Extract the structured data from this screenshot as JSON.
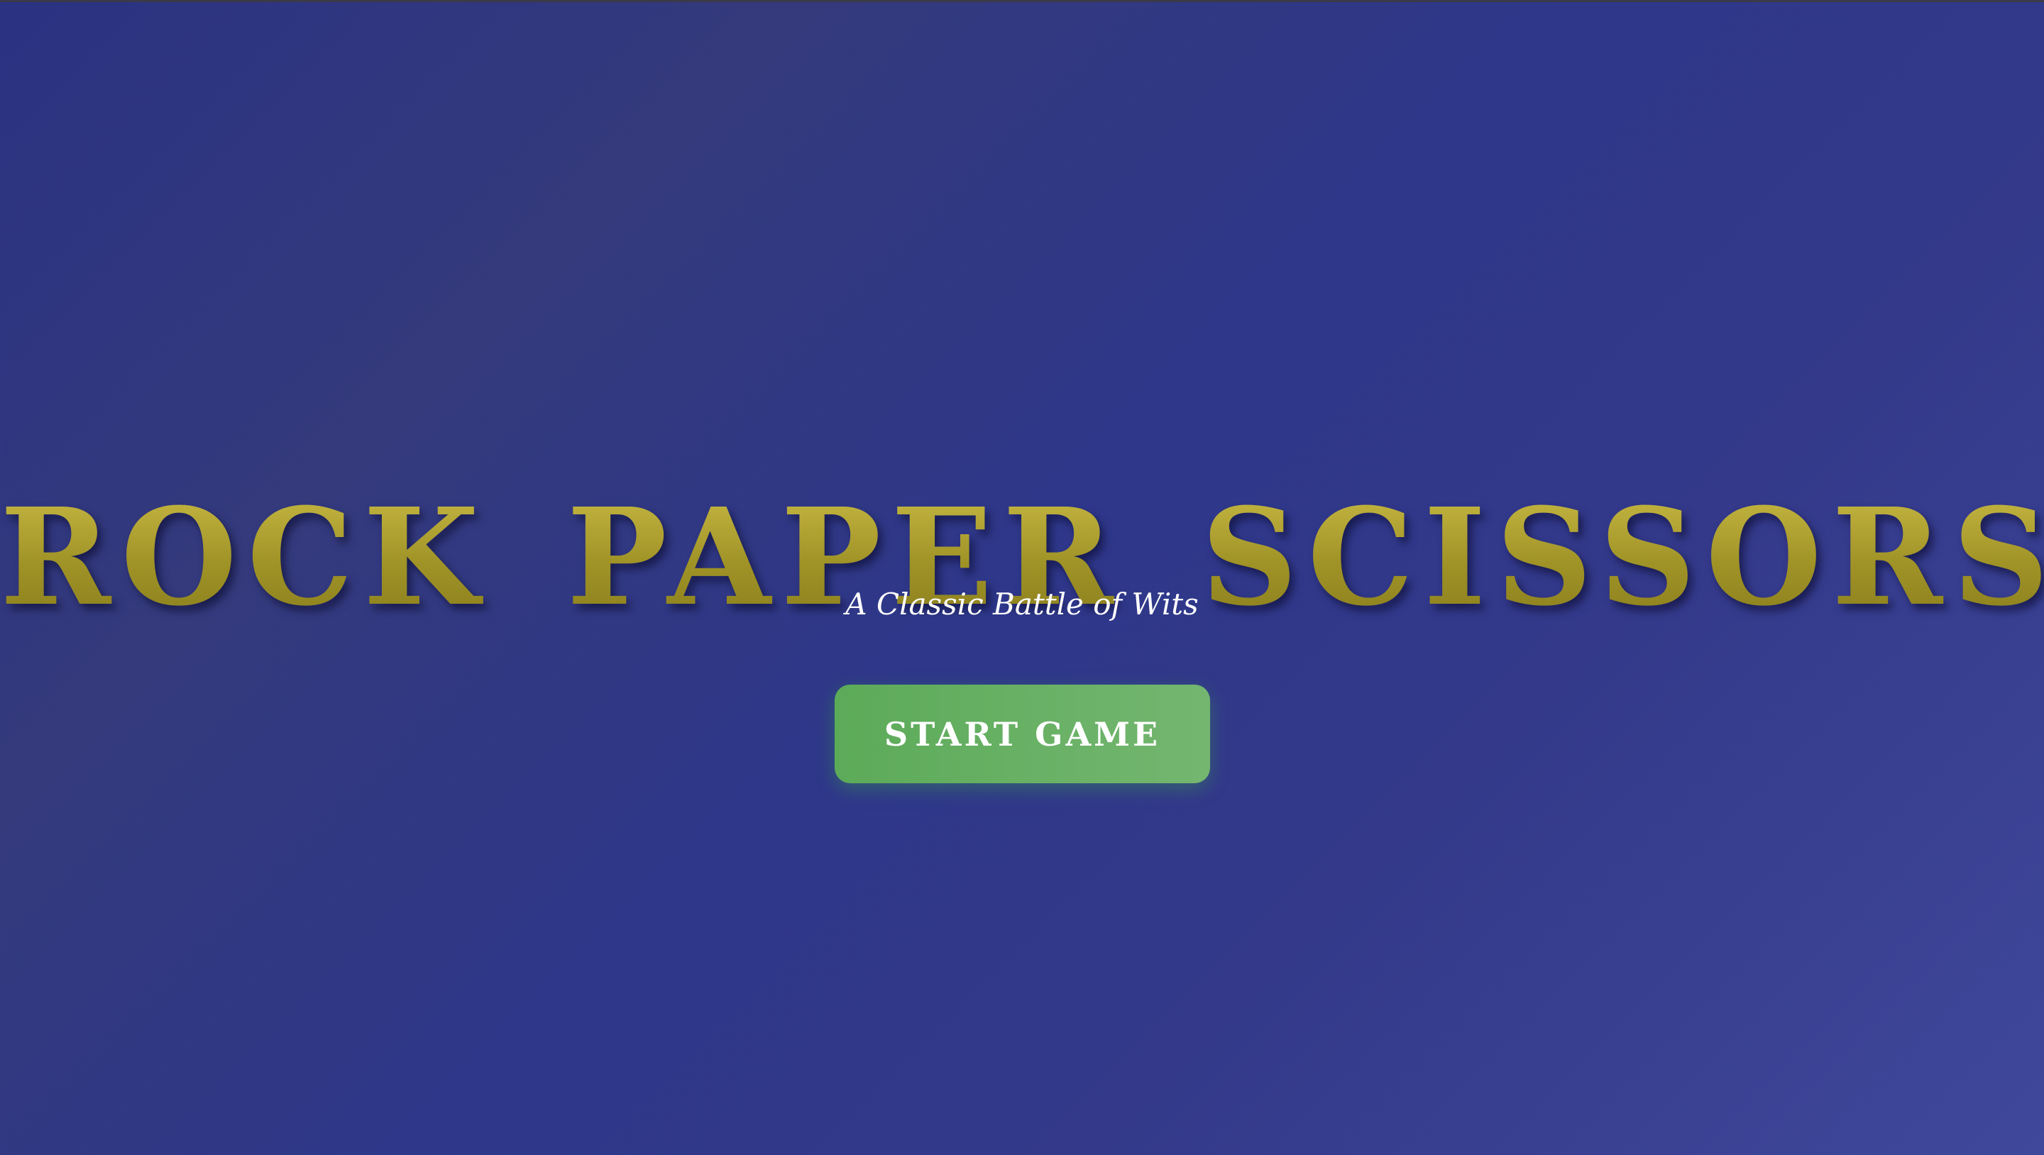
{
  "game": {
    "title": "ROCK PAPER SCISSORS",
    "subtitle": "A Classic Battle of Wits",
    "start_button_label": "START GAME"
  },
  "colors": {
    "background": "#2e378a",
    "title_gold": "#a89a2a",
    "button_green": "#66b062",
    "text_white": "#ffffff"
  }
}
